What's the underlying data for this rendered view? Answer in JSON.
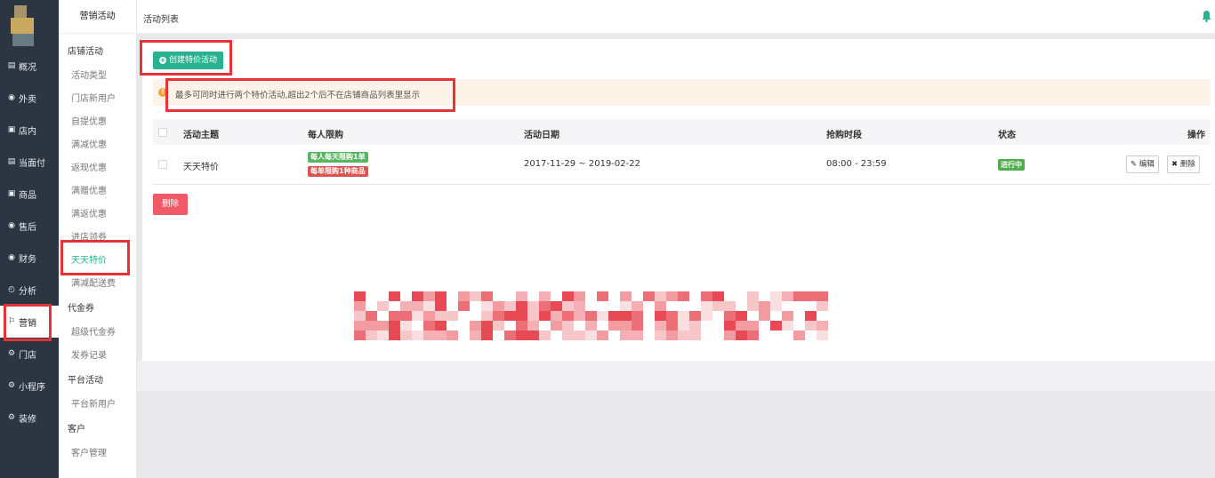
{
  "left_nav": {
    "items": [
      {
        "label": "概况",
        "icon": "dashboard-icon"
      },
      {
        "label": "外卖",
        "icon": "bike-icon"
      },
      {
        "label": "店内",
        "icon": "store-icon"
      },
      {
        "label": "当面付",
        "icon": "receipt-icon"
      },
      {
        "label": "商品",
        "icon": "bag-icon"
      },
      {
        "label": "售后",
        "icon": "aftersale-icon"
      },
      {
        "label": "财务",
        "icon": "yuan-icon"
      },
      {
        "label": "分析",
        "icon": "analysis-icon"
      },
      {
        "label": "营销",
        "icon": "marketing-icon",
        "active": true
      },
      {
        "label": "门店",
        "icon": "gear-icon"
      },
      {
        "label": "小程序",
        "icon": "gear-icon"
      },
      {
        "label": "装修",
        "icon": "gear-icon"
      }
    ]
  },
  "sub_nav": {
    "title": "营销活动",
    "groups": [
      {
        "label": "店铺活动",
        "links": [
          "活动类型",
          "门店新用户",
          "自提优惠",
          "满减优惠",
          "返现优惠",
          "满赠优惠",
          "满返优惠",
          "进店领券",
          "天天特价",
          "满减配送费"
        ]
      },
      {
        "label": "代金券",
        "links": [
          "超级代金券",
          "发券记录"
        ]
      },
      {
        "label": "平台活动",
        "links": [
          "平台新用户"
        ]
      },
      {
        "label": "客户",
        "links": [
          "客户管理"
        ]
      }
    ],
    "active_link": "天天特价"
  },
  "header": {
    "title": "活动列表"
  },
  "toolbar": {
    "create_label": "创建特价活动"
  },
  "notice": {
    "text": "最多可同时进行两个特价活动,超出2个后不在店铺商品列表里显示"
  },
  "table": {
    "columns": [
      "活动主题",
      "每人限购",
      "活动日期",
      "抢购时段",
      "状态",
      "操作"
    ],
    "rows": [
      {
        "theme": "天天特价",
        "limit_tags": [
          "每人每天限购1单",
          "每单限购1种商品"
        ],
        "date": "2017-11-29 ~ 2019-02-22",
        "time_slot": "08:00 - 23:59",
        "status": "进行中",
        "edit_label": "编辑",
        "delete_label": "删除"
      }
    ]
  },
  "bulk_delete_label": "删除",
  "colors": {
    "sidebar": "#2b3642",
    "accent": "#29b290",
    "danger": "#f05a66",
    "annotation": "#e63338"
  }
}
